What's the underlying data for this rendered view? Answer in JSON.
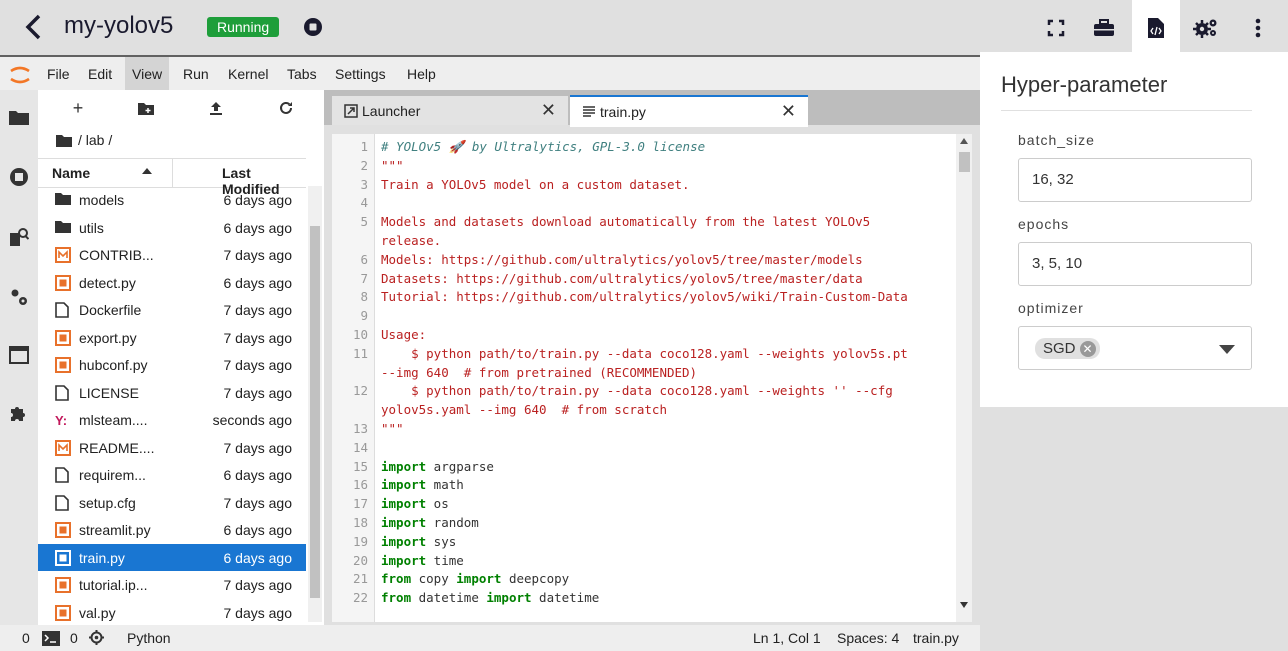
{
  "app": {
    "title": "my-yolov5",
    "status": "Running",
    "accent": "#1976d2",
    "status_color": "#1e9e3a"
  },
  "topbar_icons": [
    "back-icon",
    "stop-icon",
    "fullscreen-icon",
    "toolbox-icon",
    "code-file-icon",
    "gears-icon",
    "more-vertical-icon"
  ],
  "menu": [
    "File",
    "Edit",
    "View",
    "Run",
    "Kernel",
    "Tabs",
    "Settings",
    "Help"
  ],
  "filebrowser": {
    "breadcrumb": "/ lab /",
    "col_name": "Name",
    "col_modified": "Last Modified",
    "files": [
      {
        "name": "models",
        "modified": "6 days ago",
        "icon": "folder-icon"
      },
      {
        "name": "utils",
        "modified": "6 days ago",
        "icon": "folder-icon"
      },
      {
        "name": "CONTRIB...",
        "modified": "7 days ago",
        "icon": "markdown-file-icon"
      },
      {
        "name": "detect.py",
        "modified": "6 days ago",
        "icon": "python-file-icon"
      },
      {
        "name": "Dockerfile",
        "modified": "7 days ago",
        "icon": "file-icon"
      },
      {
        "name": "export.py",
        "modified": "7 days ago",
        "icon": "python-file-icon"
      },
      {
        "name": "hubconf.py",
        "modified": "7 days ago",
        "icon": "python-file-icon"
      },
      {
        "name": "LICENSE",
        "modified": "7 days ago",
        "icon": "file-icon"
      },
      {
        "name": "mlsteam....",
        "modified": "seconds ago",
        "icon": "yaml-file-icon"
      },
      {
        "name": "README....",
        "modified": "7 days ago",
        "icon": "markdown-file-icon"
      },
      {
        "name": "requirem...",
        "modified": "6 days ago",
        "icon": "file-icon"
      },
      {
        "name": "setup.cfg",
        "modified": "7 days ago",
        "icon": "file-icon"
      },
      {
        "name": "streamlit.py",
        "modified": "6 days ago",
        "icon": "python-file-icon"
      },
      {
        "name": "train.py",
        "modified": "6 days ago",
        "icon": "python-file-icon",
        "selected": true
      },
      {
        "name": "tutorial.ip...",
        "modified": "7 days ago",
        "icon": "notebook-file-icon"
      },
      {
        "name": "val.py",
        "modified": "7 days ago",
        "icon": "python-file-icon"
      }
    ]
  },
  "tabs": [
    {
      "label": "Launcher"
    },
    {
      "label": "train.py",
      "active": true
    }
  ],
  "code_lines": [
    {
      "n": "1",
      "t": "# YOLOv5 🚀 by Ultralytics, GPL-3.0 license",
      "c": "cmt"
    },
    {
      "n": "2",
      "t": "\"\"\"",
      "c": "str"
    },
    {
      "n": "3",
      "t": "Train a YOLOv5 model on a custom dataset.",
      "c": "str"
    },
    {
      "n": "4",
      "t": "",
      "c": "str"
    },
    {
      "n": "5",
      "t": "Models and datasets download automatically from the latest YOLOv5",
      "c": "str"
    },
    {
      "n": "",
      "t": "release.",
      "c": "str"
    },
    {
      "n": "6",
      "t": "Models: https://github.com/ultralytics/yolov5/tree/master/models",
      "c": "str"
    },
    {
      "n": "7",
      "t": "Datasets: https://github.com/ultralytics/yolov5/tree/master/data",
      "c": "str"
    },
    {
      "n": "8",
      "t": "Tutorial: https://github.com/ultralytics/yolov5/wiki/Train-Custom-Data",
      "c": "str"
    },
    {
      "n": "9",
      "t": "",
      "c": "str"
    },
    {
      "n": "10",
      "t": "Usage:",
      "c": "str"
    },
    {
      "n": "11",
      "t": "    $ python path/to/train.py --data coco128.yaml --weights yolov5s.pt",
      "c": "str"
    },
    {
      "n": "",
      "t": "--img 640  # from pretrained (RECOMMENDED)",
      "c": "str"
    },
    {
      "n": "12",
      "t": "    $ python path/to/train.py --data coco128.yaml --weights '' --cfg",
      "c": "str"
    },
    {
      "n": "",
      "t": "yolov5s.yaml --img 640  # from scratch",
      "c": "str"
    },
    {
      "n": "13",
      "t": "\"\"\"",
      "c": "str"
    },
    {
      "n": "14",
      "t": "",
      "c": "str"
    },
    {
      "n": "15",
      "kw": "import",
      "t": " argparse",
      "c": "kw"
    },
    {
      "n": "16",
      "kw": "import",
      "t": " math",
      "c": "kw"
    },
    {
      "n": "17",
      "kw": "import",
      "t": " os",
      "c": "kw"
    },
    {
      "n": "18",
      "kw": "import",
      "t": " random",
      "c": "kw"
    },
    {
      "n": "19",
      "kw": "import",
      "t": " sys",
      "c": "kw"
    },
    {
      "n": "20",
      "kw": "import",
      "t": " time",
      "c": "kw"
    },
    {
      "n": "21",
      "kw": "from",
      "t": " copy ",
      "kw2": "import",
      "t2": " deepcopy",
      "c": "kw"
    },
    {
      "n": "22",
      "kw": "from",
      "t": " datetime ",
      "kw2": "import",
      "t2": " datetime",
      "c": "kw"
    }
  ],
  "statusbar": {
    "terminals": "0",
    "kernels": "0",
    "kernel_name": "Python",
    "position": "Ln 1, Col 1",
    "spaces": "Spaces: 4",
    "filename": "train.py"
  },
  "hyper": {
    "title": "Hyper-parameter",
    "batch_label": "batch_size",
    "batch_value": "16, 32",
    "epochs_label": "epochs",
    "epochs_value": "3, 5, 10",
    "optimizer_label": "optimizer",
    "optimizer_value": "SGD"
  }
}
